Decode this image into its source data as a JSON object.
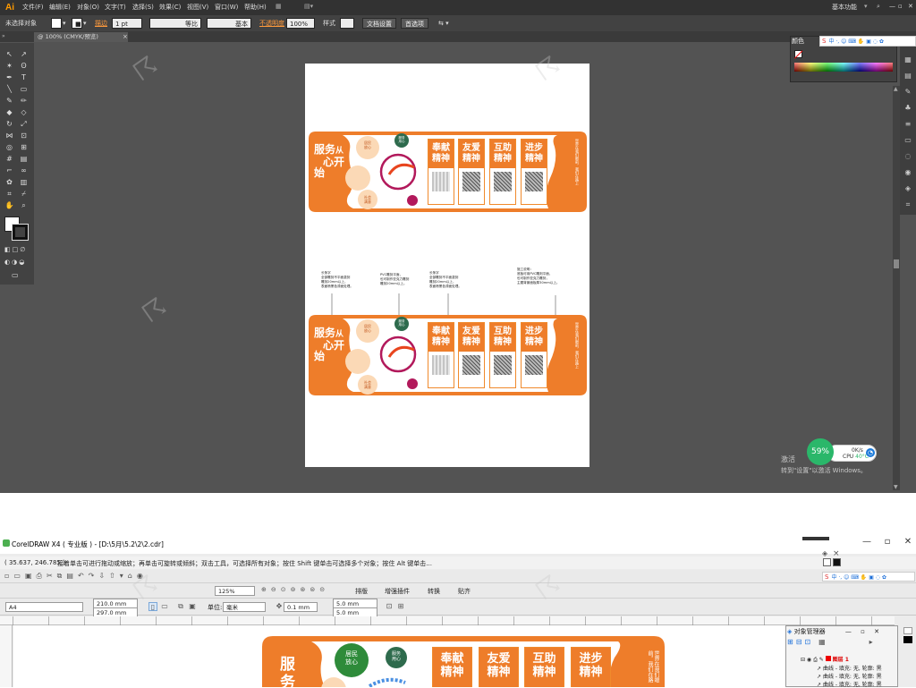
{
  "ai": {
    "menu": [
      "文件(F)",
      "编辑(E)",
      "对象(O)",
      "文字(T)",
      "选择(S)",
      "效果(C)",
      "视图(V)",
      "窗口(W)",
      "帮助(H)"
    ],
    "workspace": "基本功能",
    "control": {
      "selection": "未选择对象",
      "stroke_label": "描边",
      "stroke_weight": "1 pt",
      "profile": "等比",
      "brush": "基本",
      "opacity_label": "不透明度",
      "opacity": "100%",
      "style_label": "样式",
      "doc_setup": "文档设置",
      "prefs": "首选项"
    },
    "doc_tab": "@ 100% (CMYK/预览)",
    "color_tab": "颜色",
    "activate_title": "激活",
    "activate_hint": "转到\"设置\"以激活 Windows。",
    "perf": {
      "pct": "59%",
      "net": "0K/s",
      "cpu_label": "CPU",
      "cpu_temp": "40°C"
    }
  },
  "design": {
    "title_chars": [
      "服",
      "务",
      "从",
      "心",
      "开",
      "始"
    ],
    "seal_left": "居民\n放心",
    "seal_top": "服务\n用心",
    "seal_bottom": "社会\n满意",
    "cards": [
      {
        "title": "奉献\n精神"
      },
      {
        "title": "友爱\n精神"
      },
      {
        "title": "互助\n精神"
      },
      {
        "title": "进步\n精神"
      }
    ],
    "side_text": "世界在我们眼前，我们在路上",
    "notes": [
      "长条字\n全部雕刻不平面激刻\n雕刻20mm以上，\n表面喷黑色漆面处理。",
      "PVC雕刻平面，\n也可制作亚克力雕刻\n雕刻20mm以上。",
      "长条字\n全部雕刻不平面激刻\n雕刻20mm以上，\n表面喷黑色漆面处理。",
      "施工说明：\n底板可用PVC雕刻平面，\n也可制作亚克力雕刻，\n主题背景面板厚30mm以上。"
    ]
  },
  "cd": {
    "title": "CorelDRAW X4 ( 专业版 ) - [D:\\5月\\5.2\\2\\2.cdr]",
    "coord": "( 35.637, 246.785 )",
    "status": "接着单击可进行拖动或缩放；再单击可旋转或倾斜；双击工具，可选择所有对象；按住 Shift 键单击可选择多个对象；按住 Alt 键单击...",
    "zoom": "125%",
    "menu_items": [
      "排版",
      "增强插件",
      "转换",
      "贴齐"
    ],
    "page_size": "A4",
    "width": "210.0 mm",
    "height": "297.0 mm",
    "units_label": "单位:",
    "units": "毫米",
    "nudge": "0.1 mm",
    "dup_x": "5.0 mm",
    "dup_y": "5.0 mm",
    "objmgr_title": "对象管理器",
    "layer": "图层 1",
    "obj_rows": [
      "曲线 - 填充: 无, 轮廓: 黑",
      "曲线 - 填充: 无, 轮廓: 黑",
      "曲线 - 填充: 无, 轮廓: 黑"
    ]
  },
  "colors": {
    "orange": "#ee7d2a",
    "peach": "#fbd9b6",
    "ai_bg": "#535353"
  }
}
